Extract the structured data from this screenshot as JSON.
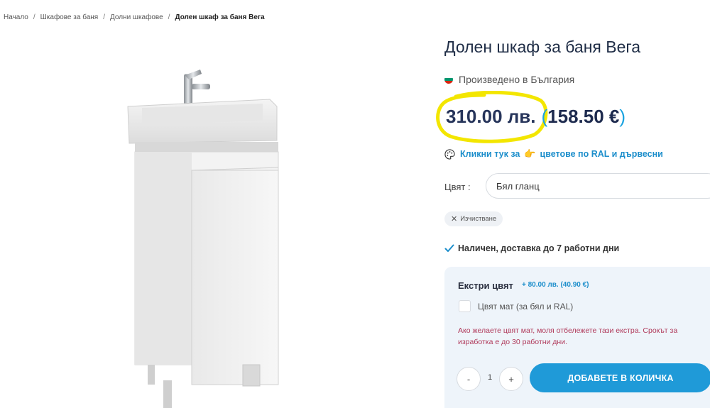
{
  "breadcrumb": {
    "items": [
      "Начало",
      "Шкафове за баня",
      "Долни шкафове"
    ],
    "current": "Долен шкаф за баня Вега",
    "separator": "/"
  },
  "product": {
    "title": "Долен шкаф за баня Вега",
    "origin": "Произведено в България",
    "price_bgn": "310.00 лв.",
    "price_eur": "158.50 €",
    "paren_open": "(",
    "paren_close": ")"
  },
  "ral_link": {
    "text_start": "Кликни тук за",
    "pointer_emoji": "👉",
    "text_end": "цветове по RAL и дървесни"
  },
  "color": {
    "label": "Цвят :",
    "selected": "Бял гланц"
  },
  "clear_button": {
    "icon": "✕",
    "label": "Изчистване"
  },
  "stock": {
    "text": "Наличен, доставка до 7 работни дни"
  },
  "extras": {
    "title": "Екстри цвят",
    "price": "+ 80.00 лв. (40.90 €)",
    "checkbox_label": "Цвят мат (за бял и RAL)",
    "notice": "Ако желаете цвят мат, моля отбележете тази екстра. Срокът за изработка е до 30 работни дни."
  },
  "quantity": {
    "minus": "-",
    "value": "1",
    "plus": "+"
  },
  "cart": {
    "button": "ДОБАВЕТЕ В КОЛИЧКА"
  },
  "colors": {
    "accent": "#1f9ad8",
    "title": "#1f2d46",
    "highlight": "#f3e600",
    "notice": "#b03a5b",
    "panel": "#eef4fa"
  },
  "icons": [
    "flag-bulgaria-icon",
    "palette-icon",
    "check-icon",
    "close-icon"
  ]
}
